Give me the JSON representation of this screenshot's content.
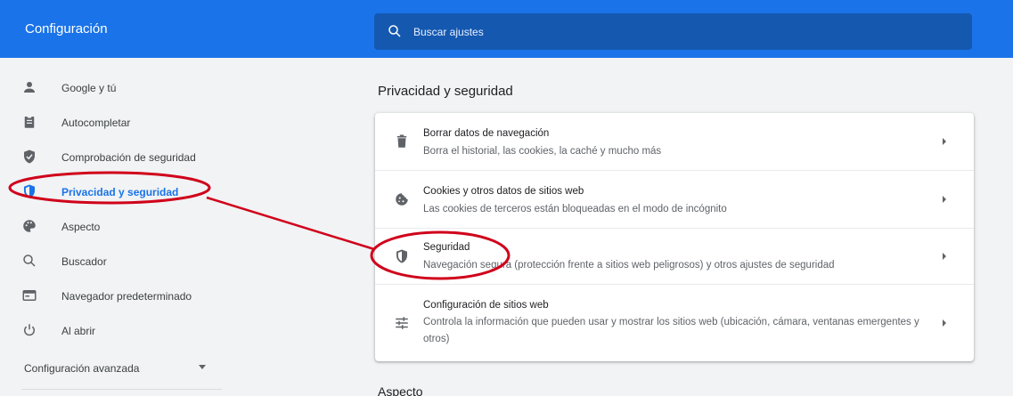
{
  "header": {
    "title": "Configuración",
    "search_placeholder": "Buscar ajustes"
  },
  "sidebar": {
    "items": [
      {
        "label": "Google y tú",
        "icon": "person-icon"
      },
      {
        "label": "Autocompletar",
        "icon": "clipboard-icon"
      },
      {
        "label": "Comprobación de seguridad",
        "icon": "shield-check-icon"
      },
      {
        "label": "Privacidad y seguridad",
        "icon": "shield-icon",
        "active": true
      },
      {
        "label": "Aspecto",
        "icon": "palette-icon"
      },
      {
        "label": "Buscador",
        "icon": "search-icon"
      },
      {
        "label": "Navegador predeterminado",
        "icon": "browser-icon"
      },
      {
        "label": "Al abrir",
        "icon": "power-icon"
      }
    ],
    "advanced_label": "Configuración avanzada"
  },
  "main": {
    "section_title": "Privacidad y seguridad",
    "rows": [
      {
        "title": "Borrar datos de navegación",
        "description": "Borra el historial, las cookies, la caché y mucho más",
        "icon": "trash-icon"
      },
      {
        "title": "Cookies y otros datos de sitios web",
        "description": "Las cookies de terceros están bloqueadas en el modo de incógnito",
        "icon": "cookie-icon"
      },
      {
        "title": "Seguridad",
        "description": "Navegación segura (protección frente a sitios web peligrosos) y otros ajustes de seguridad",
        "icon": "shield-icon"
      },
      {
        "title": "Configuración de sitios web",
        "description": "Controla la información que pueden usar y mostrar los sitios web (ubicación, cámara, ventanas emergentes y otros)",
        "icon": "tune-icon"
      }
    ],
    "next_section_title": "Aspecto"
  },
  "colors": {
    "brand_blue": "#1a73e8",
    "annotation_red": "#d0021b"
  }
}
